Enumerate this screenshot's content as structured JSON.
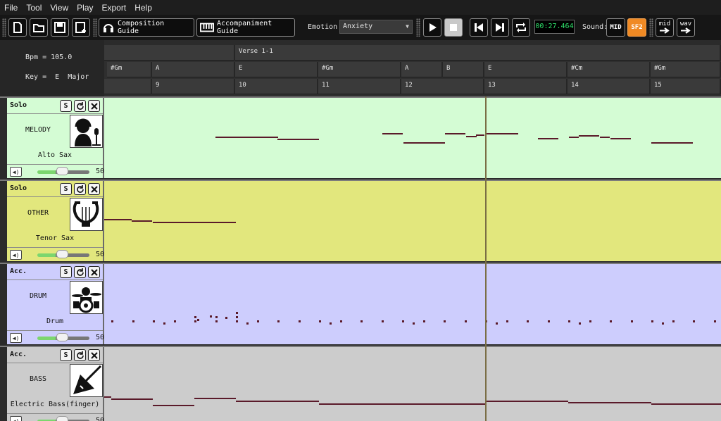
{
  "menu": [
    "File",
    "Tool",
    "View",
    "Play",
    "Export",
    "Help"
  ],
  "toolbar": {
    "composition_guide": "Composition Guide",
    "accompaniment_guide": "Accompaniment Guide",
    "emotion_label": "Emotion",
    "emotion_value": "Anxiety",
    "time": "00:27.464",
    "sound_label": "Sound:",
    "mid_label": "MID",
    "sf2_label": "SF2",
    "export_mid_label": "mid",
    "export_wav_label": "wav"
  },
  "info": {
    "bpm": "Bpm = 105.0",
    "key": "Key =  E  Major"
  },
  "timeline": {
    "section": "Verse 1-1",
    "chords": [
      "#Gm",
      "A",
      "E",
      "#Gm",
      "A",
      "B",
      "E",
      "#Cm",
      "#Gm"
    ],
    "measures": [
      "",
      "9",
      "10",
      "11",
      "12",
      "13",
      "14",
      "15"
    ]
  },
  "tracks": [
    {
      "type": "Solo",
      "name": "MELODY",
      "instrument": "Alto Sax",
      "volume": "50",
      "color": "#d4fcd4",
      "avatar": "singer-avatar-icon",
      "notes": [
        [
          158,
          89,
          55
        ],
        [
          246,
          59,
          58
        ],
        [
          395,
          29,
          50
        ],
        [
          425,
          59,
          63
        ],
        [
          484,
          29,
          50
        ],
        [
          514,
          15,
          54
        ],
        [
          528,
          12,
          52
        ],
        [
          543,
          45,
          50
        ],
        [
          616,
          29,
          57
        ],
        [
          660,
          14,
          55
        ],
        [
          674,
          29,
          53
        ],
        [
          704,
          14,
          55
        ],
        [
          719,
          29,
          57
        ],
        [
          777,
          59,
          63
        ]
      ]
    },
    {
      "type": "Solo",
      "name": "OTHER",
      "instrument": "Tenor Sax",
      "volume": "50",
      "color": "#e2e77d",
      "avatar": "lyre-avatar-icon",
      "notes": [
        [
          0,
          39,
          54
        ],
        [
          39,
          29,
          56
        ],
        [
          69,
          118,
          58
        ]
      ]
    },
    {
      "type": "Acc.",
      "name": "DRUM",
      "instrument": "Drum",
      "volume": "50",
      "color": "#cdcdfd",
      "avatar": "drum-kit-avatar-icon",
      "notes": []
    },
    {
      "type": "Acc.",
      "name": "BASS",
      "instrument": "Electric Bass(finger)",
      "volume": "50",
      "color": "#cccccc",
      "avatar": "bass-guitar-avatar-icon",
      "notes": [
        [
          0,
          10,
          70
        ],
        [
          10,
          59,
          73
        ],
        [
          69,
          59,
          82
        ],
        [
          128,
          59,
          72
        ],
        [
          187,
          118,
          76
        ],
        [
          305,
          118,
          80
        ],
        [
          423,
          118,
          80
        ],
        [
          541,
          118,
          76
        ],
        [
          659,
          118,
          78
        ],
        [
          777,
          99,
          80
        ]
      ]
    }
  ],
  "colors": {
    "note": "#5a1a2a",
    "playhead": "#7a6e45",
    "sf2_accent": "#f08a24",
    "time_text": "#2fe06a"
  }
}
